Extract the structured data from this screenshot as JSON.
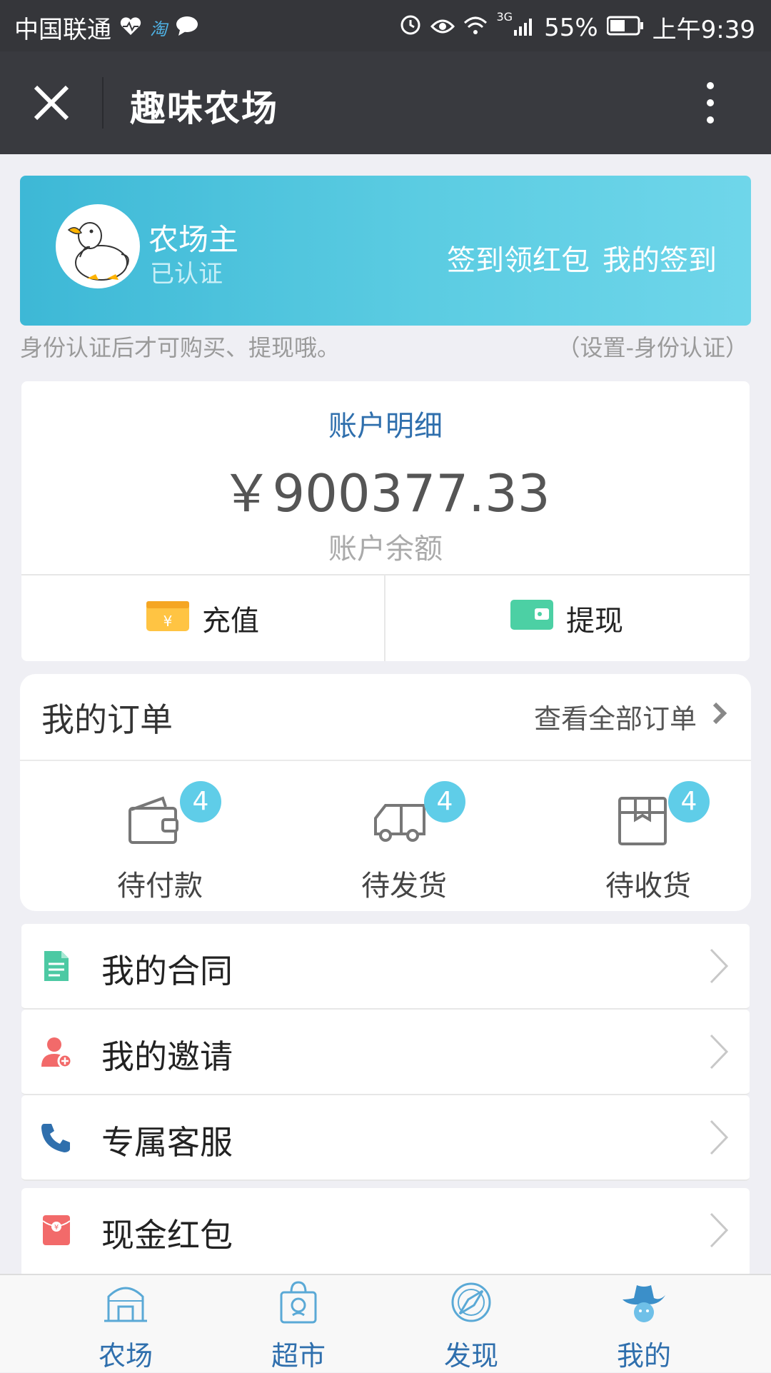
{
  "status_bar": {
    "carrier": "中国联通",
    "taobao": "淘",
    "network": "3G",
    "battery": "55%",
    "time": "上午9:39"
  },
  "nav": {
    "title": "趣味农场"
  },
  "profile": {
    "name": "农场主",
    "status": "已认证",
    "sign_in_label": "签到领红包",
    "my_sign_in_label": "我的签到"
  },
  "notice": {
    "text": "身份认证后才可购买、提现哦。",
    "link": "（设置-身份认证）"
  },
  "account": {
    "title": "账户明细",
    "balance": "￥900377.33",
    "balance_label": "账户余额",
    "recharge_label": "充值",
    "withdraw_label": "提现"
  },
  "orders": {
    "title": "我的订单",
    "view_all": "查看全部订单",
    "items": [
      {
        "label": "待付款",
        "count": "4",
        "icon": "wallet-icon"
      },
      {
        "label": "待发货",
        "count": "4",
        "icon": "truck-icon"
      },
      {
        "label": "待收货",
        "count": "4",
        "icon": "box-icon"
      }
    ]
  },
  "menu": [
    {
      "label": "我的合同",
      "icon": "document-icon",
      "color": "#4cc9a3"
    },
    {
      "label": "我的邀请",
      "icon": "invite-user-icon",
      "color": "#f26a6a"
    },
    {
      "label": "专属客服",
      "icon": "phone-icon",
      "color": "#2f6fad"
    },
    {
      "label": "现金红包",
      "icon": "red-packet-icon",
      "color": "#f26a6a"
    }
  ],
  "tabs": [
    {
      "label": "农场",
      "icon": "farm-icon"
    },
    {
      "label": "超市",
      "icon": "shopping-bag-icon"
    },
    {
      "label": "发现",
      "icon": "compass-icon"
    },
    {
      "label": "我的",
      "icon": "cowboy-hat-icon"
    }
  ],
  "colors": {
    "accent": "#2f6fad",
    "banner_start": "#3db8d6",
    "banner_end": "#6fd6ea",
    "badge": "#5fcde8",
    "nav_bg": "#393a3f"
  }
}
